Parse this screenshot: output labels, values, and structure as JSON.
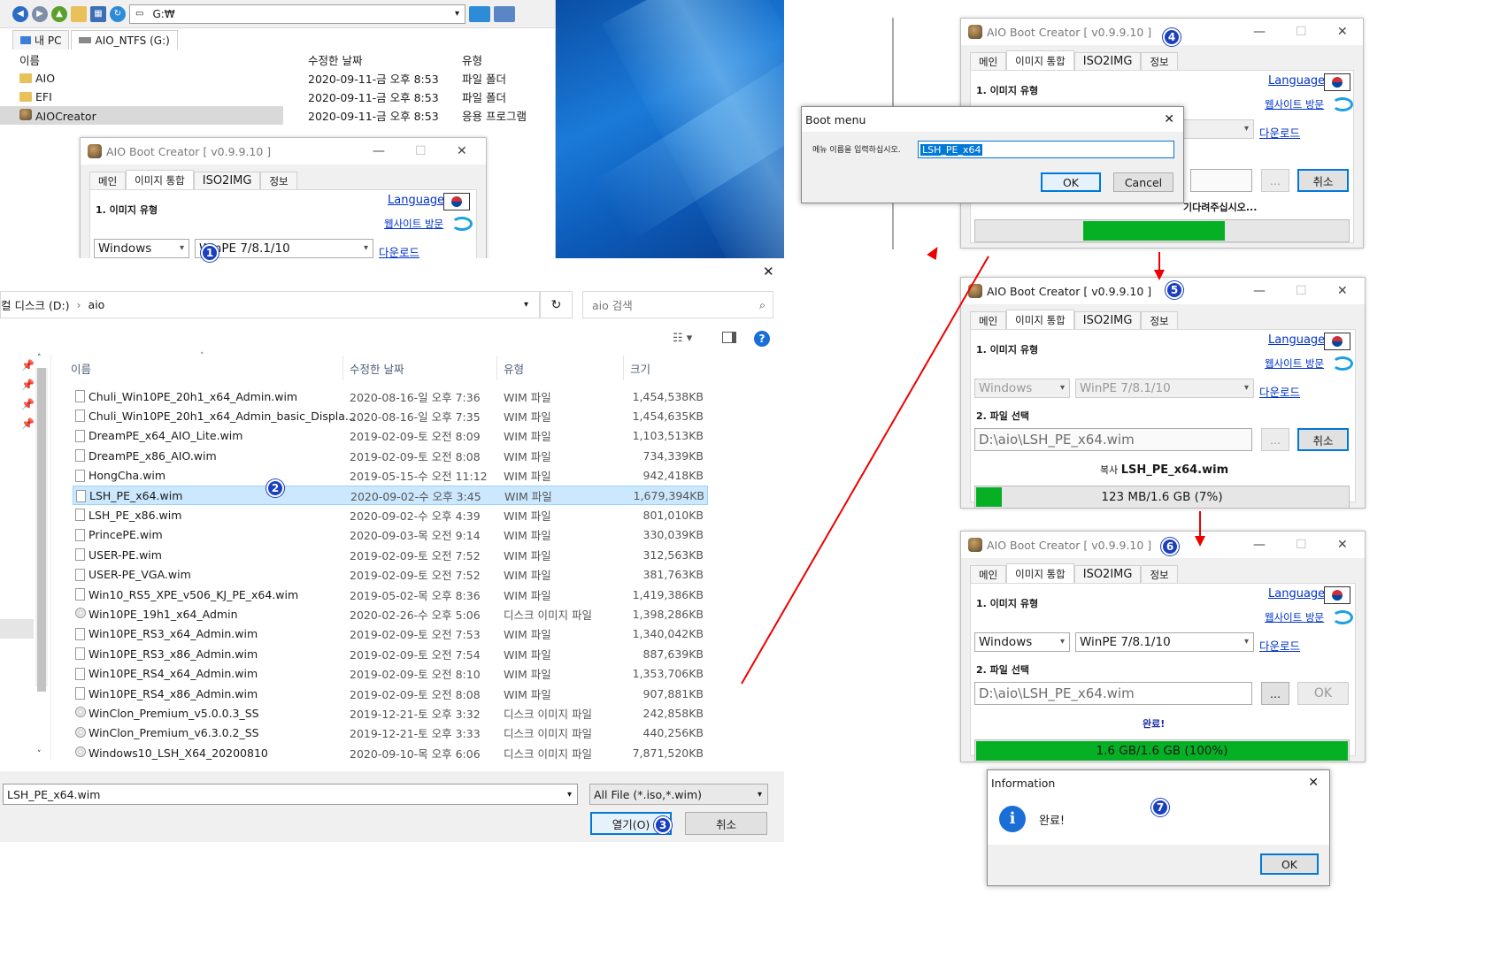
{
  "explorer": {
    "address": "G:₩",
    "tabs": [
      "내 PC",
      "AIO_NTFS (G:)"
    ],
    "columns": [
      "이름",
      "수정한 날짜",
      "유형"
    ],
    "rows": [
      {
        "name": "AIO",
        "date": "2020-09-11-금 오후 8:53",
        "type": "파일 폴더"
      },
      {
        "name": "EFI",
        "date": "2020-09-11-금 오후 8:53",
        "type": "파일 폴더"
      },
      {
        "name": "AIOCreator",
        "date": "2020-09-11-금 오후 8:53",
        "type": "응용 프로그램"
      }
    ]
  },
  "aio": {
    "title": "AIO Boot Creator [ v0.9.9.10 ]",
    "tabs": [
      "메인",
      "이미지 통합",
      "ISO2IMG",
      "정보"
    ],
    "language": "Language",
    "website": "웹사이트 방문",
    "download": "다운로드",
    "image_type_label": "1. 이미지 유형",
    "file_select_label": "2. 파일 선택",
    "os": "Windows",
    "pe": "WinPE 7/8.1/10",
    "browse": "...",
    "cancel": "취소",
    "ok": "OK",
    "file_path": "D:\\aio\\LSH_PE_x64.wim",
    "wait_text": "기다려주십시오...",
    "copy_prefix": "복사",
    "copy_file": "LSH_PE_x64.wim",
    "progress5": "123 MB/1.6 GB (7%)",
    "progress5_value": 7,
    "progress4_value": 38,
    "done": "완료!",
    "progress6": "1.6 GB/1.6 GB (100%)",
    "progress6_value": 100
  },
  "boot_menu": {
    "title": "Boot menu",
    "prompt": "메뉴 이름을 입력하십시오.",
    "value": "LSH_PE_x64",
    "ok": "OK",
    "cancel": "Cancel"
  },
  "info": {
    "title": "Information",
    "message": "완료!",
    "ok": "OK"
  },
  "open_dialog": {
    "breadcrumb": [
      "컬 디스크 (D:)",
      "aio"
    ],
    "search_placeholder": "aio 검색",
    "columns": [
      "이름",
      "수정한 날짜",
      "유형",
      "크기"
    ],
    "files": [
      {
        "name": "Chuli_Win10PE_20h1_x64_Admin.wim",
        "date": "2020-08-16-일 오후 7:36",
        "type": "WIM 파일",
        "size": "1,454,538KB"
      },
      {
        "name": "Chuli_Win10PE_20h1_x64_Admin_basic_Displa...",
        "date": "2020-08-16-일 오후 7:35",
        "type": "WIM 파일",
        "size": "1,454,635KB"
      },
      {
        "name": "DreamPE_x64_AIO_Lite.wim",
        "date": "2019-02-09-토 오전 8:09",
        "type": "WIM 파일",
        "size": "1,103,513KB"
      },
      {
        "name": "DreamPE_x86_AIO.wim",
        "date": "2019-02-09-토 오전 8:08",
        "type": "WIM 파일",
        "size": "734,339KB"
      },
      {
        "name": "HongCha.wim",
        "date": "2019-05-15-수 오전 11:12",
        "type": "WIM 파일",
        "size": "942,418KB"
      },
      {
        "name": "LSH_PE_x64.wim",
        "date": "2020-09-02-수 오후 3:45",
        "type": "WIM 파일",
        "size": "1,679,394KB",
        "selected": true
      },
      {
        "name": "LSH_PE_x86.wim",
        "date": "2020-09-02-수 오후 4:39",
        "type": "WIM 파일",
        "size": "801,010KB"
      },
      {
        "name": "PrincePE.wim",
        "date": "2020-09-03-목 오전 9:14",
        "type": "WIM 파일",
        "size": "330,039KB"
      },
      {
        "name": "USER-PE.wim",
        "date": "2019-02-09-토 오전 7:52",
        "type": "WIM 파일",
        "size": "312,563KB"
      },
      {
        "name": "USER-PE_VGA.wim",
        "date": "2019-02-09-토 오전 7:52",
        "type": "WIM 파일",
        "size": "381,763KB"
      },
      {
        "name": "Win10_RS5_XPE_v506_KJ_PE_x64.wim",
        "date": "2019-05-02-목 오후 8:36",
        "type": "WIM 파일",
        "size": "1,419,386KB"
      },
      {
        "name": "Win10PE_19h1_x64_Admin",
        "date": "2020-02-26-수 오후 5:06",
        "type": "디스크 이미지 파일",
        "size": "1,398,286KB",
        "disk": true
      },
      {
        "name": "Win10PE_RS3_x64_Admin.wim",
        "date": "2019-02-09-토 오전 7:53",
        "type": "WIM 파일",
        "size": "1,340,042KB"
      },
      {
        "name": "Win10PE_RS3_x86_Admin.wim",
        "date": "2019-02-09-토 오전 7:54",
        "type": "WIM 파일",
        "size": "887,639KB"
      },
      {
        "name": "Win10PE_RS4_x64_Admin.wim",
        "date": "2019-02-09-토 오전 8:10",
        "type": "WIM 파일",
        "size": "1,353,706KB"
      },
      {
        "name": "Win10PE_RS4_x86_Admin.wim",
        "date": "2019-02-09-토 오전 8:08",
        "type": "WIM 파일",
        "size": "907,881KB"
      },
      {
        "name": "WinClon_Premium_v5.0.0.3_SS",
        "date": "2019-12-21-토 오후 3:32",
        "type": "디스크 이미지 파일",
        "size": "242,858KB",
        "disk": true
      },
      {
        "name": "WinClon_Premium_v6.3.0.2_SS",
        "date": "2019-12-21-토 오후 3:33",
        "type": "디스크 이미지 파일",
        "size": "440,256KB",
        "disk": true
      },
      {
        "name": "Windows10_LSH_X64_20200810",
        "date": "2020-09-10-목 오후 6:06",
        "type": "디스크 이미지 파일",
        "size": "7,871,520KB",
        "disk": true
      }
    ],
    "filename": "LSH_PE_x64.wim",
    "filter": "All File (*.iso,*.wim)",
    "open": "열기(O)",
    "cancel": "취소"
  },
  "badges": [
    "1",
    "2",
    "3",
    "4",
    "5",
    "6",
    "7"
  ],
  "colors": {
    "accent": "#0078d7",
    "progress": "#06b025",
    "arrow": "#e00000",
    "badge": "#1a3fbf"
  }
}
